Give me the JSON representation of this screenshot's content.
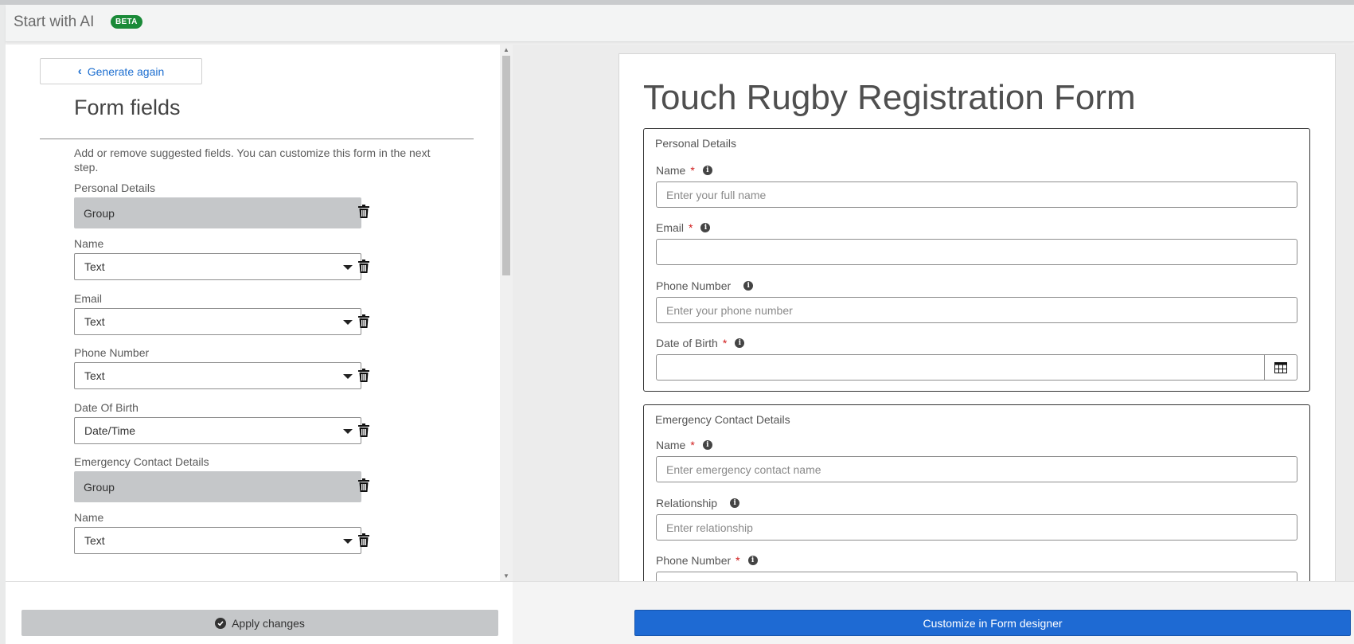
{
  "header": {
    "title": "Start with AI",
    "badge": "BETA"
  },
  "left": {
    "generate_again": "Generate again",
    "title": "Form fields",
    "description": "Add or remove suggested fields. You can customize this form in the next step.",
    "fields": [
      {
        "label": "Personal Details",
        "type": "Group",
        "kind": "group"
      },
      {
        "label": "Name",
        "type": "Text",
        "kind": "select"
      },
      {
        "label": "Email",
        "type": "Text",
        "kind": "select"
      },
      {
        "label": "Phone Number",
        "type": "Text",
        "kind": "select"
      },
      {
        "label": "Date Of Birth",
        "type": "Date/Time",
        "kind": "select"
      },
      {
        "label": "Emergency Contact Details",
        "type": "Group",
        "kind": "group"
      },
      {
        "label": "Name",
        "type": "Text",
        "kind": "select"
      }
    ],
    "apply_label": "Apply changes"
  },
  "preview": {
    "title": "Touch Rugby Registration Form",
    "sections": [
      {
        "legend": "Personal Details",
        "fields": [
          {
            "label": "Name",
            "required": "*",
            "placeholder": "Enter your full name"
          },
          {
            "label": "Email",
            "required": "*",
            "placeholder": ""
          },
          {
            "label": "Phone Number",
            "required": "",
            "placeholder": "Enter your phone number"
          },
          {
            "label": "Date of Birth",
            "required": "*",
            "placeholder": ""
          }
        ]
      },
      {
        "legend": "Emergency Contact Details",
        "fields": [
          {
            "label": "Name",
            "required": "*",
            "placeholder": "Enter emergency contact name"
          },
          {
            "label": "Relationship",
            "required": "",
            "placeholder": "Enter relationship"
          },
          {
            "label": "Phone Number",
            "required": "*",
            "placeholder": ""
          }
        ]
      }
    ],
    "customize_label": "Customize in Form designer"
  },
  "colors": {
    "accent": "#1e6ad3",
    "beta": "#1a8a38",
    "required": "#d01c1c",
    "link": "#1e6fd0"
  }
}
